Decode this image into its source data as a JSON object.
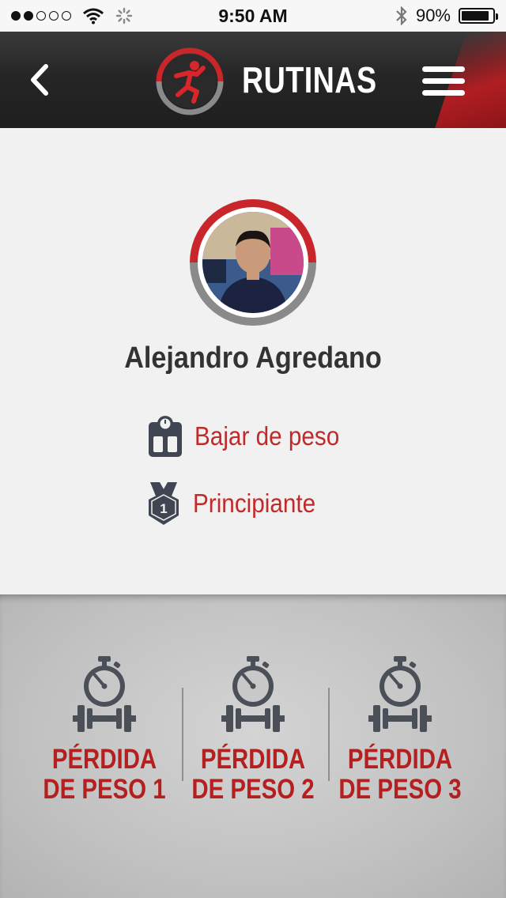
{
  "status_bar": {
    "signal_dots_filled": 2,
    "signal_dots_total": 5,
    "time": "9:50 AM",
    "battery_text": "90%",
    "battery_level": 0.9,
    "icons": [
      "wifi-icon",
      "loading-spinner-icon",
      "bluetooth-icon",
      "battery-icon"
    ]
  },
  "header": {
    "title": "RUTINAS",
    "back_icon": "chevron-left-icon",
    "menu_icon": "hamburger-menu-icon",
    "logo_icon": "running-man-logo-icon"
  },
  "profile": {
    "name": "Alejandro Agredano",
    "goal_icon": "scale-icon",
    "goal": "Bajar de peso",
    "level_icon": "medal-icon",
    "level_badge": "1",
    "level": "Principiante"
  },
  "routines": [
    {
      "label": "PÉRDIDA\nDE PESO 1",
      "icon": "stopwatch-dumbbell-icon"
    },
    {
      "label": "PÉRDIDA\nDE PESO 2",
      "icon": "stopwatch-dumbbell-icon"
    },
    {
      "label": "PÉRDIDA\nDE PESO 3",
      "icon": "stopwatch-dumbbell-icon"
    }
  ],
  "colors": {
    "accent_red": "#c22a2a",
    "routine_red": "#b3201f",
    "header_dark": "#262626",
    "text_dark": "#333333"
  }
}
